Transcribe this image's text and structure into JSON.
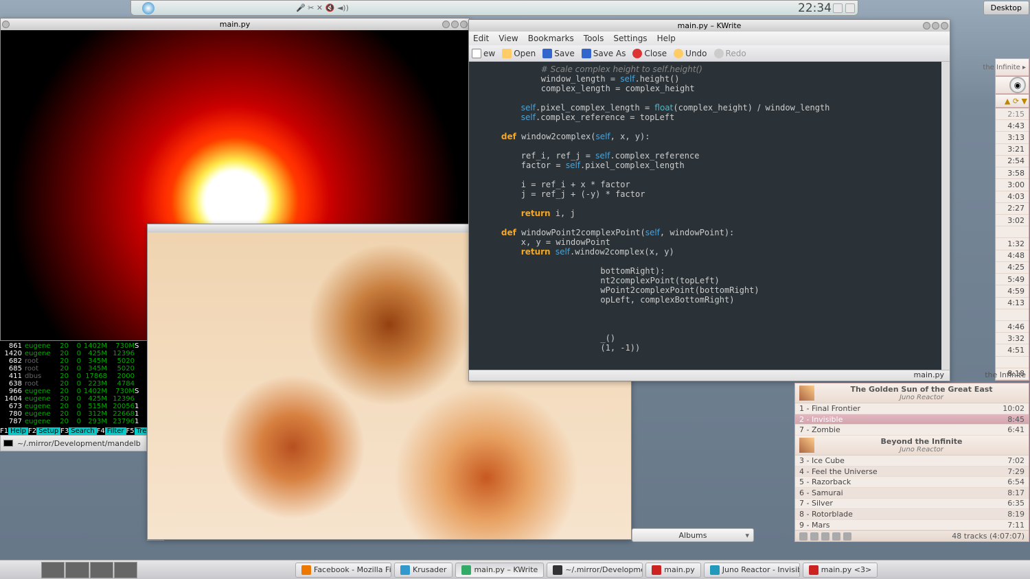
{
  "panel": {
    "clock": "22:34",
    "desktop_btn": "Desktop"
  },
  "fractal1": {
    "title": "main.py"
  },
  "crumb": {
    "path": "~/.mirror/Development/mandelb"
  },
  "htop": {
    "rows": [
      {
        "pid": "861",
        "user": "eugene",
        "a": "20",
        "b": "0",
        "m1": "1402M",
        "m2": "730M",
        "x": "S"
      },
      {
        "pid": "1420",
        "user": "eugene",
        "a": "20",
        "b": "0",
        "m1": "425M",
        "m2": "12396",
        "x": ""
      },
      {
        "pid": "682",
        "user": "root",
        "a": "20",
        "b": "0",
        "m1": "345M",
        "m2": "5020",
        "x": ""
      },
      {
        "pid": "685",
        "user": "root",
        "a": "20",
        "b": "0",
        "m1": "345M",
        "m2": "5020",
        "x": ""
      },
      {
        "pid": "411",
        "user": "dbus",
        "a": "20",
        "b": "0",
        "m1": "17868",
        "m2": "2000",
        "x": ""
      },
      {
        "pid": "638",
        "user": "root",
        "a": "20",
        "b": "0",
        "m1": "223M",
        "m2": "4784",
        "x": ""
      },
      {
        "pid": "966",
        "user": "eugene",
        "a": "20",
        "b": "0",
        "m1": "1402M",
        "m2": "730M",
        "x": "S"
      },
      {
        "pid": "1404",
        "user": "eugene",
        "a": "20",
        "b": "0",
        "m1": "425M",
        "m2": "12396",
        "x": ""
      },
      {
        "pid": "673",
        "user": "eugene",
        "a": "20",
        "b": "0",
        "m1": "515M",
        "m2": "20056",
        "x": "1"
      },
      {
        "pid": "780",
        "user": "eugene",
        "a": "20",
        "b": "0",
        "m1": "312M",
        "m2": "22668",
        "x": "1"
      },
      {
        "pid": "787",
        "user": "eugene",
        "a": "20",
        "b": "0",
        "m1": "293M",
        "m2": "23796",
        "x": "1"
      }
    ],
    "fkeys": [
      [
        "F1",
        "Help"
      ],
      [
        "F2",
        "Setup"
      ],
      [
        "F3",
        "Search"
      ],
      [
        "F4",
        "Filter"
      ],
      [
        "F5",
        "Tre"
      ]
    ]
  },
  "kwrite": {
    "title": "main.py – KWrite",
    "menu": [
      "Edit",
      "View",
      "Bookmarks",
      "Tools",
      "Settings",
      "Help"
    ],
    "toolbar": {
      "new": "ew",
      "open": "Open",
      "save": "Save",
      "saveas": "Save As",
      "close": "Close",
      "undo": "Undo",
      "redo": "Redo"
    },
    "status": "main.py",
    "code_lines": [
      {
        "indent": 12,
        "seg": [
          [
            "cmt",
            "# Scale complex height to self.height()"
          ]
        ]
      },
      {
        "indent": 12,
        "seg": [
          [
            "",
            "window_length = "
          ],
          [
            "slf",
            "self"
          ],
          [
            "",
            ".height()"
          ]
        ]
      },
      {
        "indent": 12,
        "seg": [
          [
            "",
            "complex_length = complex_height"
          ]
        ]
      },
      {
        "indent": 0,
        "seg": [
          [
            "",
            ""
          ]
        ]
      },
      {
        "indent": 8,
        "seg": [
          [
            "slf",
            "self"
          ],
          [
            "",
            ".pixel_complex_length = "
          ],
          [
            "fn",
            "float"
          ],
          [
            "",
            "(complex_height) "
          ],
          [
            "op",
            "/"
          ],
          [
            "",
            " window_length"
          ]
        ]
      },
      {
        "indent": 8,
        "seg": [
          [
            "slf",
            "self"
          ],
          [
            "",
            ".complex_reference = topLeft"
          ]
        ]
      },
      {
        "indent": 0,
        "seg": [
          [
            "",
            ""
          ]
        ]
      },
      {
        "indent": 4,
        "seg": [
          [
            "kw",
            "def"
          ],
          [
            "",
            " window2complex("
          ],
          [
            "slf",
            "self"
          ],
          [
            "",
            ", x, y):"
          ]
        ]
      },
      {
        "indent": 0,
        "seg": [
          [
            "",
            ""
          ]
        ]
      },
      {
        "indent": 8,
        "seg": [
          [
            "",
            "ref_i, ref_j = "
          ],
          [
            "slf",
            "self"
          ],
          [
            "",
            ".complex_reference"
          ]
        ]
      },
      {
        "indent": 8,
        "seg": [
          [
            "",
            "factor = "
          ],
          [
            "slf",
            "self"
          ],
          [
            "",
            ".pixel_complex_length"
          ]
        ]
      },
      {
        "indent": 0,
        "seg": [
          [
            "",
            ""
          ]
        ]
      },
      {
        "indent": 8,
        "seg": [
          [
            "",
            "i = ref_i + x * factor"
          ]
        ]
      },
      {
        "indent": 8,
        "seg": [
          [
            "",
            "j = ref_j + (-y) * factor"
          ]
        ]
      },
      {
        "indent": 0,
        "seg": [
          [
            "",
            ""
          ]
        ]
      },
      {
        "indent": 8,
        "seg": [
          [
            "kw",
            "return"
          ],
          [
            "",
            " i, j"
          ]
        ]
      },
      {
        "indent": 0,
        "seg": [
          [
            "",
            ""
          ]
        ]
      },
      {
        "indent": 4,
        "seg": [
          [
            "kw",
            "def"
          ],
          [
            "",
            " windowPoint2complexPoint("
          ],
          [
            "slf",
            "self"
          ],
          [
            "",
            ", windowPoint):"
          ]
        ]
      },
      {
        "indent": 8,
        "seg": [
          [
            "",
            "x, y = windowPoint"
          ]
        ]
      },
      {
        "indent": 8,
        "seg": [
          [
            "kw",
            "return"
          ],
          [
            "",
            " "
          ],
          [
            "slf",
            "self"
          ],
          [
            "",
            ".window2complex(x, y)"
          ]
        ]
      },
      {
        "indent": 0,
        "seg": [
          [
            "",
            ""
          ]
        ]
      },
      {
        "indent": 24,
        "seg": [
          [
            "",
            "bottomRight):"
          ]
        ]
      },
      {
        "indent": 24,
        "seg": [
          [
            "",
            "nt2complexPoint(topLeft)"
          ]
        ]
      },
      {
        "indent": 24,
        "seg": [
          [
            "",
            "wPoint2complexPoint(bottomRight)"
          ]
        ]
      },
      {
        "indent": 24,
        "seg": [
          [
            "",
            "opLeft, complexBottomRight)"
          ]
        ]
      },
      {
        "indent": 0,
        "seg": [
          [
            "",
            ""
          ]
        ]
      },
      {
        "indent": 0,
        "seg": [
          [
            "",
            ""
          ]
        ]
      },
      {
        "indent": 0,
        "seg": [
          [
            "",
            ""
          ]
        ]
      },
      {
        "indent": 24,
        "seg": [
          [
            "",
            "_()"
          ]
        ]
      },
      {
        "indent": 24,
        "seg": [
          [
            "",
            "(1, -1))"
          ]
        ]
      }
    ]
  },
  "amarok": {
    "top_times": [
      "2:15",
      "4:43",
      "3:13",
      "3:21",
      "2:54",
      "3:58",
      "3:00",
      "4:03",
      "2:27",
      "3:02",
      "",
      "1:32",
      "4:48",
      "4:25",
      "5:49",
      "4:59",
      "4:13",
      "",
      "4:46",
      "3:32",
      "4:51",
      "",
      "8:18"
    ],
    "infinite_hint": "the Infinite ▸",
    "albums": [
      {
        "title": "The Golden Sun of the Great East",
        "artist": "Juno Reactor",
        "tracks": [
          {
            "n": "1",
            "name": "Final Frontier",
            "dur": "10:02",
            "cls": ""
          },
          {
            "n": "2",
            "name": "Invisible",
            "dur": "8:45",
            "cls": "playing"
          },
          {
            "n": "7",
            "name": "Zombie",
            "dur": "6:41",
            "cls": ""
          }
        ]
      },
      {
        "title": "Beyond the Infinite",
        "artist": "Juno Reactor",
        "tracks": [
          {
            "n": "3",
            "name": "Ice Cube",
            "dur": "7:02",
            "cls": ""
          },
          {
            "n": "4",
            "name": "Feel the Universe",
            "dur": "7:29",
            "cls": "alt"
          },
          {
            "n": "5",
            "name": "Razorback",
            "dur": "6:54",
            "cls": ""
          },
          {
            "n": "6",
            "name": "Samurai",
            "dur": "8:17",
            "cls": "alt"
          },
          {
            "n": "7",
            "name": "Silver",
            "dur": "6:35",
            "cls": ""
          },
          {
            "n": "8",
            "name": "Rotorblade",
            "dur": "8:19",
            "cls": "alt"
          },
          {
            "n": "9",
            "name": "Mars",
            "dur": "7:11",
            "cls": ""
          }
        ]
      }
    ],
    "footer": "48 tracks (4:07:07)",
    "combo": "Albums"
  },
  "taskbar": {
    "tasks": [
      {
        "ico": "i-ff",
        "label": "Facebook - Mozilla Fire",
        "active": false
      },
      {
        "ico": "i-kr",
        "label": "Krusader",
        "active": false
      },
      {
        "ico": "i-kw",
        "label": "main.py – KWrite",
        "active": true
      },
      {
        "ico": "i-term",
        "label": "~/.mirror/Development",
        "active": false
      },
      {
        "ico": "i-py",
        "label": "main.py",
        "active": false
      },
      {
        "ico": "i-am",
        "label": "Juno Reactor - Invisibl",
        "active": false
      },
      {
        "ico": "i-py",
        "label": "main.py <3>",
        "active": false
      }
    ]
  }
}
